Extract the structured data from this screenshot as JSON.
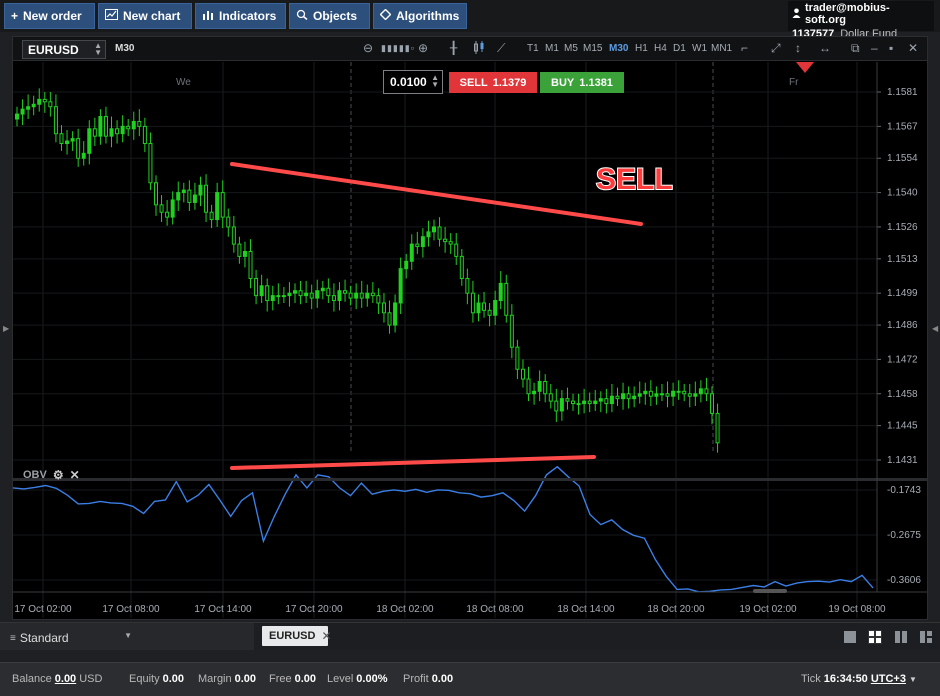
{
  "toolbar": {
    "buttons": [
      {
        "label": "New order",
        "icon": "plus-icon"
      },
      {
        "label": "New chart",
        "icon": "chart-icon"
      },
      {
        "label": "Indicators",
        "icon": "bars-icon"
      },
      {
        "label": "Objects",
        "icon": "objects-icon"
      },
      {
        "label": "Algorithms",
        "icon": "diamond-icon"
      }
    ]
  },
  "account": {
    "email": "trader@mobius-soft.org",
    "number": "1137577",
    "fund": "Dollar Fund"
  },
  "chart": {
    "symbol": "EURUSD",
    "timeframe": "M30",
    "timeframes": [
      "T1",
      "M1",
      "M5",
      "M15",
      "M30",
      "H1",
      "H4",
      "D1",
      "W1",
      "MN1"
    ],
    "active_timeframe": "M30",
    "lot": "0.0100",
    "sell_label": "SELL",
    "sell_price": "1.1379",
    "buy_label": "BUY",
    "buy_price": "1.1381",
    "annotation": "SELL",
    "day_labels": [
      "We",
      "Fr"
    ],
    "indicator": "OBV",
    "bull_color": "#1fd21f",
    "obv_color": "#3b7fe6",
    "trendline_color": "#ff4a4a"
  },
  "chart_data": {
    "type": "candlestick",
    "price_ticks": [
      "1.1581",
      "1.1567",
      "1.1554",
      "1.1540",
      "1.1526",
      "1.1513",
      "1.1499",
      "1.1486",
      "1.1472",
      "1.1458",
      "1.1445",
      "1.1431"
    ],
    "obv_ticks": [
      "-0.1743",
      "-0.2675",
      "-0.3606"
    ],
    "time_ticks": [
      "17 Oct 02:00",
      "17 Oct 08:00",
      "17 Oct 14:00",
      "17 Oct 20:00",
      "18 Oct 02:00",
      "18 Oct 08:00",
      "18 Oct 14:00",
      "18 Oct 20:00",
      "19 Oct 02:00",
      "19 Oct 08:00"
    ],
    "close": [
      1.1572,
      1.1574,
      1.1575,
      1.1576,
      1.1578,
      1.1577,
      1.1575,
      1.1564,
      1.156,
      1.1561,
      1.1562,
      1.1554,
      1.1556,
      1.1566,
      1.1563,
      1.1571,
      1.1563,
      1.1566,
      1.1564,
      1.1567,
      1.1566,
      1.1569,
      1.1567,
      1.156,
      1.1544,
      1.1535,
      1.1532,
      1.153,
      1.1537,
      1.154,
      1.1541,
      1.1536,
      1.1539,
      1.1543,
      1.1532,
      1.1529,
      1.154,
      1.153,
      1.1526,
      1.1519,
      1.1514,
      1.1516,
      1.1505,
      1.1498,
      1.1502,
      1.1496,
      1.1498,
      1.1498,
      1.1498,
      1.1499,
      1.15,
      1.1498,
      1.1499,
      1.1497,
      1.15,
      1.1501,
      1.1498,
      1.1496,
      1.15,
      1.1499,
      1.1497,
      1.1499,
      1.1497,
      1.1499,
      1.1498,
      1.1495,
      1.1491,
      1.1486,
      1.1495,
      1.1509,
      1.1512,
      1.1519,
      1.1518,
      1.1522,
      1.1524,
      1.1526,
      1.1521,
      1.152,
      1.1519,
      1.1514,
      1.1505,
      1.1499,
      1.1491,
      1.1495,
      1.1492,
      1.149,
      1.1496,
      1.1503,
      1.149,
      1.1477,
      1.1468,
      1.1464,
      1.1458,
      1.1459,
      1.1463,
      1.1458,
      1.1455,
      1.1451,
      1.1456,
      1.1455,
      1.1454,
      1.1454,
      1.1455,
      1.1454,
      1.1455,
      1.1456,
      1.1454,
      1.1457,
      1.1456,
      1.1458,
      1.1456,
      1.1457,
      1.1458,
      1.1459,
      1.1457,
      1.1458,
      1.1458,
      1.1457,
      1.1459,
      1.1459,
      1.1458,
      1.1457,
      1.1458,
      1.146,
      1.1458,
      1.145,
      1.1438
    ],
    "obv": [
      -0.17,
      -0.172,
      -0.169,
      -0.165,
      -0.171,
      -0.185,
      -0.203,
      -0.202,
      -0.198,
      -0.201,
      -0.202,
      -0.208,
      -0.223,
      -0.198,
      -0.195,
      -0.157,
      -0.199,
      -0.185,
      -0.163,
      -0.195,
      -0.229,
      -0.196,
      -0.18,
      -0.28,
      -0.229,
      -0.183,
      -0.143,
      -0.17,
      -0.143,
      -0.147,
      -0.17,
      -0.186,
      -0.16,
      -0.183,
      -0.177,
      -0.174,
      -0.177,
      -0.173,
      -0.179,
      -0.174,
      -0.175,
      -0.18,
      -0.182,
      -0.189,
      -0.186,
      -0.18,
      -0.196,
      -0.218,
      -0.186,
      -0.143,
      -0.126,
      -0.147,
      -0.166,
      -0.225,
      -0.246,
      -0.236,
      -0.256,
      -0.268,
      -0.274,
      -0.318,
      -0.353,
      -0.38,
      -0.379,
      -0.385,
      -0.384,
      -0.381,
      -0.38,
      -0.376,
      -0.372,
      -0.375,
      -0.364,
      -0.373,
      -0.367,
      -0.364,
      -0.363,
      -0.365,
      -0.36,
      -0.364,
      -0.351,
      -0.377
    ]
  },
  "workspace": {
    "name": "Standard",
    "tab": "EURUSD"
  },
  "status": {
    "balance_label": "Balance",
    "balance": "0.00",
    "currency": "USD",
    "equity_label": "Equity",
    "equity": "0.00",
    "margin_label": "Margin",
    "margin": "0.00",
    "free_label": "Free",
    "free": "0.00",
    "level_label": "Level",
    "level": "0.00%",
    "profit_label": "Profit",
    "profit": "0.00",
    "tick_label": "Tick",
    "time": "16:34:50",
    "tz": "UTC+3"
  }
}
